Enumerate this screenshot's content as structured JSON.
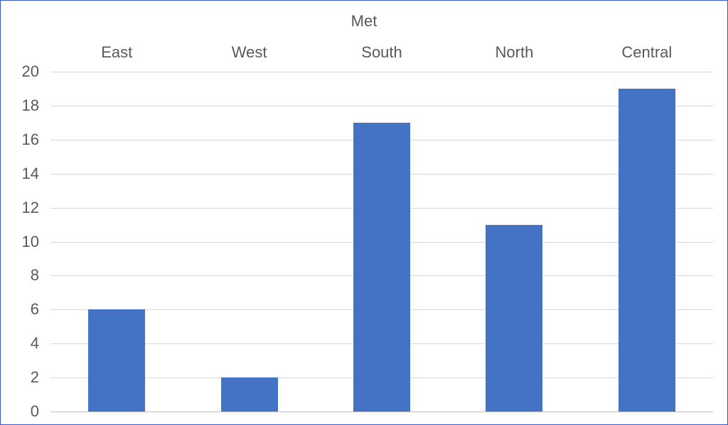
{
  "chart_data": {
    "type": "bar",
    "title": "Met",
    "categories": [
      "East",
      "West",
      "South",
      "North",
      "Central"
    ],
    "values": [
      6,
      2,
      17,
      11,
      19
    ],
    "y_ticks": [
      0,
      2,
      4,
      6,
      8,
      10,
      12,
      14,
      16,
      18,
      20
    ],
    "ylim": [
      0,
      20
    ],
    "xlabel": "",
    "ylabel": "",
    "grid": true,
    "bar_color": "#4472c4",
    "border_color": "#3658cf"
  }
}
